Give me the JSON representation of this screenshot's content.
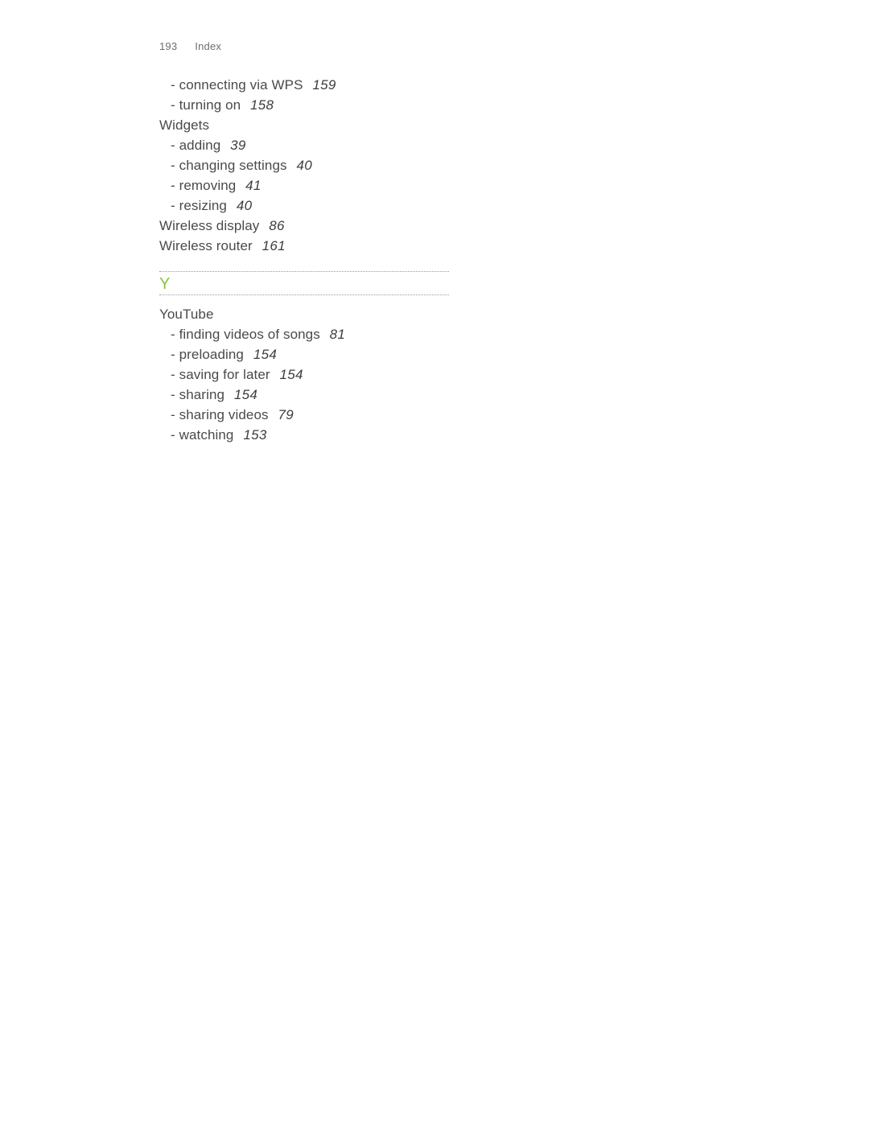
{
  "header": {
    "folio": "193",
    "section": "Index"
  },
  "colors": {
    "letter_accent": "#85c441",
    "body_text": "#4a4a4a",
    "header_text": "#6e6e6e",
    "divider": "#9b9b9b",
    "page_background": "#ffffff"
  },
  "index": {
    "continued_group": {
      "entries": [
        {
          "level": 2,
          "dash": "-",
          "label": "connecting via WPS",
          "folio": "159"
        },
        {
          "level": 2,
          "dash": "-",
          "label": "turning on",
          "folio": "158"
        }
      ]
    },
    "groups": [
      {
        "heading": {
          "level": 1,
          "label": "Widgets",
          "folio": ""
        },
        "entries": [
          {
            "level": 2,
            "dash": "-",
            "label": "adding",
            "folio": "39"
          },
          {
            "level": 2,
            "dash": "-",
            "label": "changing settings",
            "folio": "40"
          },
          {
            "level": 2,
            "dash": "-",
            "label": "removing",
            "folio": "41"
          },
          {
            "level": 2,
            "dash": "-",
            "label": "resizing",
            "folio": "40"
          }
        ]
      }
    ],
    "standalone_entries": [
      {
        "level": 1,
        "label": "Wireless display",
        "folio": "86"
      },
      {
        "level": 1,
        "label": "Wireless router",
        "folio": "161"
      }
    ],
    "letter_divider": {
      "letter": "Y"
    },
    "letter_y_groups": [
      {
        "heading": {
          "level": 1,
          "label": "YouTube",
          "folio": ""
        },
        "entries": [
          {
            "level": 2,
            "dash": "-",
            "label": "finding videos of songs",
            "folio": "81"
          },
          {
            "level": 2,
            "dash": "-",
            "label": "preloading",
            "folio": "154"
          },
          {
            "level": 2,
            "dash": "-",
            "label": "saving for later",
            "folio": "154"
          },
          {
            "level": 2,
            "dash": "-",
            "label": "sharing",
            "folio": "154"
          },
          {
            "level": 2,
            "dash": "-",
            "label": "sharing videos",
            "folio": "79"
          },
          {
            "level": 2,
            "dash": "-",
            "label": "watching",
            "folio": "153"
          }
        ]
      }
    ]
  }
}
